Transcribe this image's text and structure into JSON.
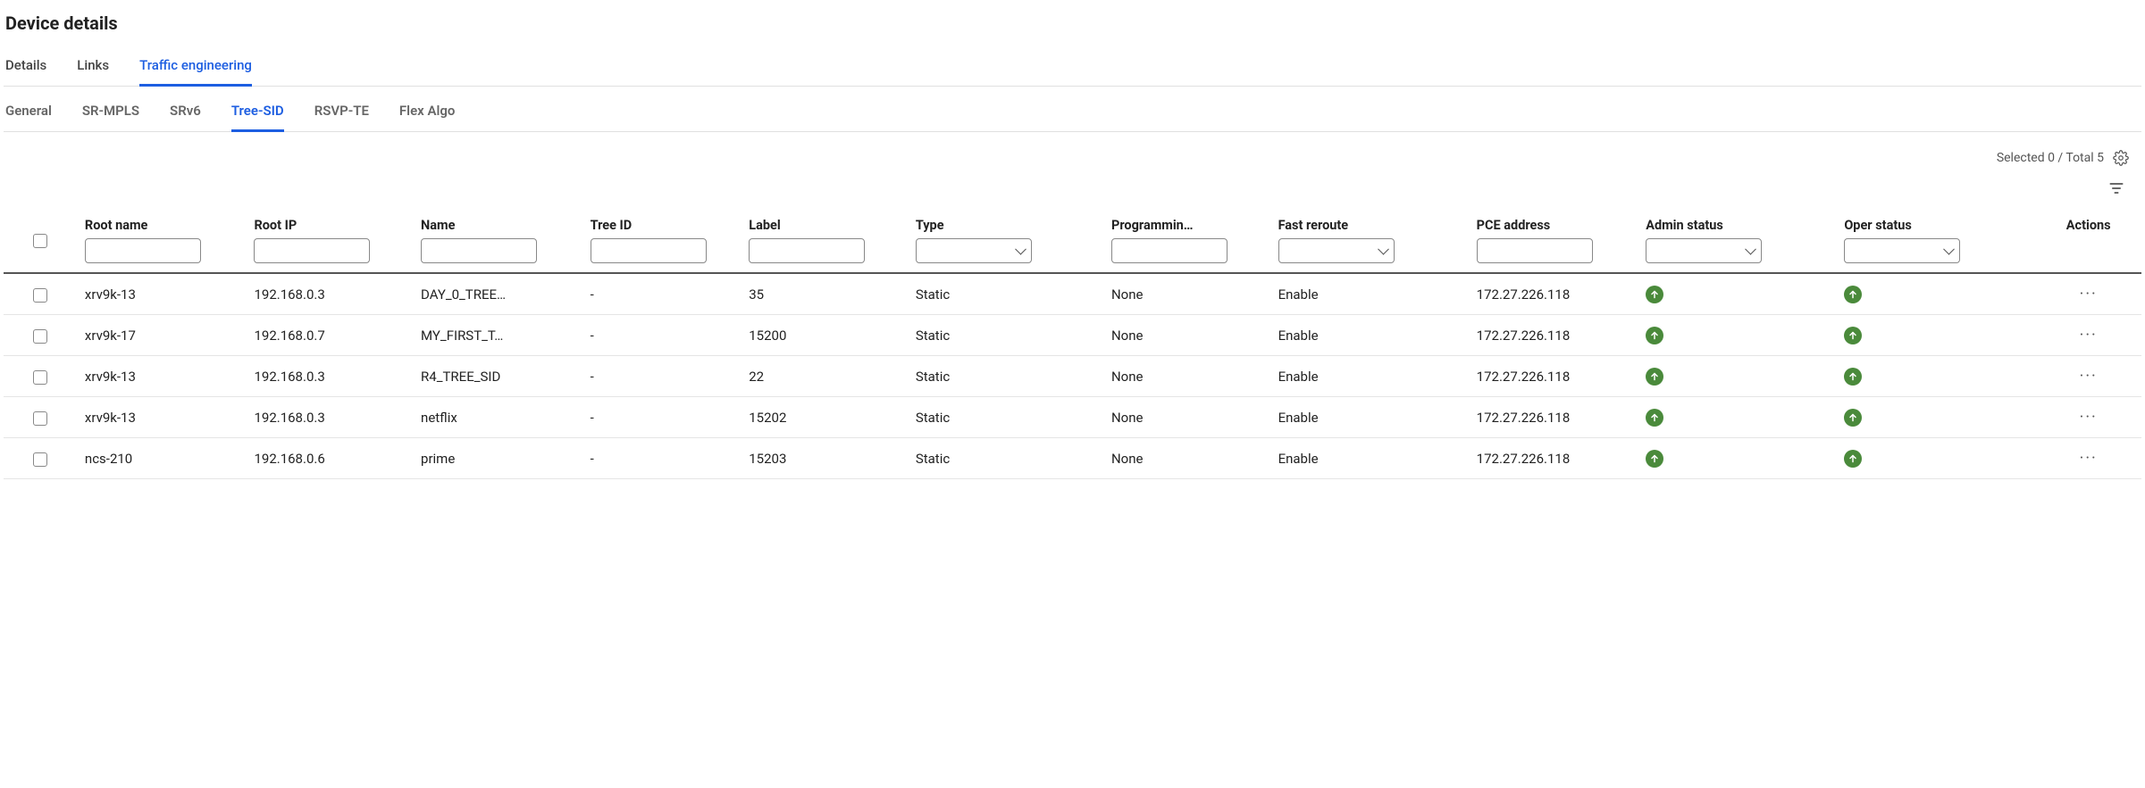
{
  "title": "Device details",
  "primaryTabs": [
    {
      "label": "Details",
      "active": false
    },
    {
      "label": "Links",
      "active": false
    },
    {
      "label": "Traffic engineering",
      "active": true
    }
  ],
  "secondaryTabs": [
    {
      "label": "General",
      "active": false
    },
    {
      "label": "SR-MPLS",
      "active": false
    },
    {
      "label": "SRv6",
      "active": false
    },
    {
      "label": "Tree-SID",
      "active": true
    },
    {
      "label": "RSVP-TE",
      "active": false
    },
    {
      "label": "Flex Algo",
      "active": false
    }
  ],
  "tableMeta": {
    "selectionSummary": "Selected 0 / Total 5"
  },
  "columns": {
    "rootName": "Root name",
    "rootIp": "Root IP",
    "name": "Name",
    "treeId": "Tree ID",
    "label": "Label",
    "type": "Type",
    "programming": "Programmin…",
    "fastReroute": "Fast reroute",
    "pceAddress": "PCE address",
    "adminStatus": "Admin status",
    "operStatus": "Oper status",
    "actions": "Actions"
  },
  "rows": [
    {
      "rootName": "xrv9k-13",
      "rootIp": "192.168.0.3",
      "name": "DAY_0_TREE…",
      "treeId": "-",
      "label": "35",
      "type": "Static",
      "programming": "None",
      "fastReroute": "Enable",
      "pce": "172.27.226.118",
      "adminUp": true,
      "operUp": true
    },
    {
      "rootName": "xrv9k-17",
      "rootIp": "192.168.0.7",
      "name": "MY_FIRST_T…",
      "treeId": "-",
      "label": "15200",
      "type": "Static",
      "programming": "None",
      "fastReroute": "Enable",
      "pce": "172.27.226.118",
      "adminUp": true,
      "operUp": true
    },
    {
      "rootName": "xrv9k-13",
      "rootIp": "192.168.0.3",
      "name": "R4_TREE_SID",
      "treeId": "-",
      "label": "22",
      "type": "Static",
      "programming": "None",
      "fastReroute": "Enable",
      "pce": "172.27.226.118",
      "adminUp": true,
      "operUp": true
    },
    {
      "rootName": "xrv9k-13",
      "rootIp": "192.168.0.3",
      "name": "netflix",
      "treeId": "-",
      "label": "15202",
      "type": "Static",
      "programming": "None",
      "fastReroute": "Enable",
      "pce": "172.27.226.118",
      "adminUp": true,
      "operUp": true
    },
    {
      "rootName": "ncs-210",
      "rootIp": "192.168.0.6",
      "name": "prime",
      "treeId": "-",
      "label": "15203",
      "type": "Static",
      "programming": "None",
      "fastReroute": "Enable",
      "pce": "172.27.226.118",
      "adminUp": true,
      "operUp": true
    }
  ]
}
